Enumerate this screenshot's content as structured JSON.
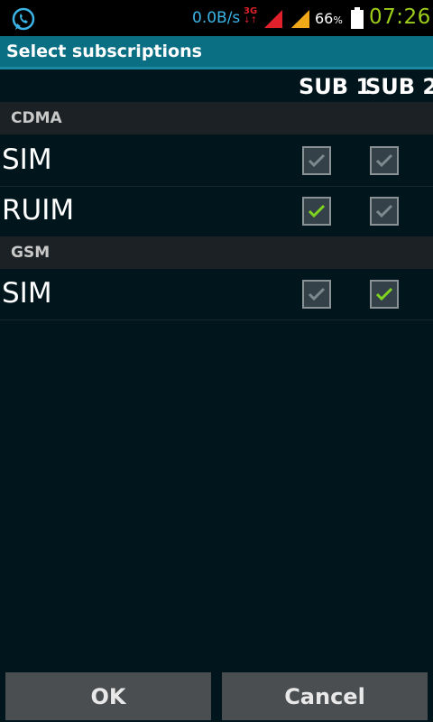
{
  "status_bar": {
    "app_icon": "whatsapp-icon",
    "net_speed": "0.0B/s",
    "network_type": "3G",
    "battery_percent": "66",
    "battery_unit": "%",
    "time": "07:26"
  },
  "dialog": {
    "title": "Select subscriptions",
    "columns": [
      "SUB 1",
      "SUB 2"
    ],
    "sections": [
      {
        "header": "CDMA",
        "rows": [
          {
            "label": "SIM",
            "sub1": true,
            "sub1_enabled": false,
            "sub2": true,
            "sub2_enabled": false
          },
          {
            "label": "RUIM",
            "sub1": true,
            "sub1_enabled": true,
            "sub2": true,
            "sub2_enabled": false
          }
        ]
      },
      {
        "header": "GSM",
        "rows": [
          {
            "label": "SIM",
            "sub1": true,
            "sub1_enabled": false,
            "sub2": true,
            "sub2_enabled": true
          }
        ]
      }
    ],
    "buttons": {
      "ok": "OK",
      "cancel": "Cancel"
    }
  },
  "colors": {
    "check_active": "#7ed321",
    "check_inactive": "#7c8a90",
    "title_bg": "#0b6f83",
    "time": "#9ccd1a"
  }
}
